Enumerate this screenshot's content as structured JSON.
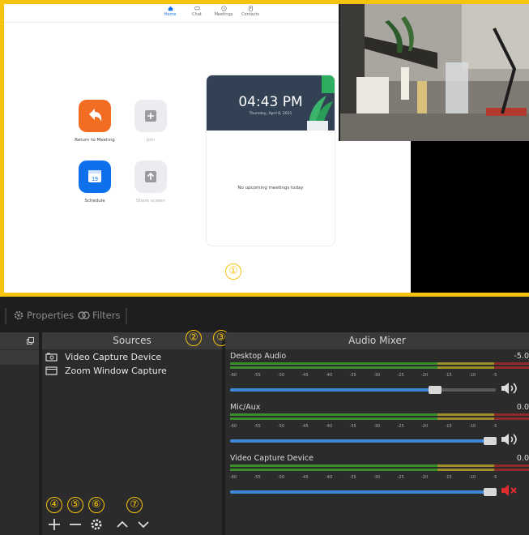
{
  "zoom": {
    "nav": [
      {
        "label": "Home",
        "icon": "home-icon",
        "active": true
      },
      {
        "label": "Chat",
        "icon": "chat-icon",
        "active": false
      },
      {
        "label": "Meetings",
        "icon": "clock-icon",
        "active": false
      },
      {
        "label": "Contacts",
        "icon": "contacts-icon",
        "active": false
      }
    ],
    "actions": [
      {
        "label": "Return to Meeting",
        "color": "#f26d21",
        "icon": "return-arrow-icon"
      },
      {
        "label": "Join",
        "color": "#ececf0",
        "icon": "plus-icon"
      },
      {
        "label": "Schedule",
        "color": "#0e71eb",
        "icon": "calendar-icon",
        "day": "19"
      },
      {
        "label": "Share screen",
        "color": "#ececf0",
        "icon": "share-up-arrow-icon"
      }
    ],
    "card": {
      "time": "04:43 PM",
      "date": "Thursday, April 8, 2021",
      "empty_text": "No upcoming meetings today"
    }
  },
  "annotations": [
    "①",
    "②",
    "③",
    "④",
    "⑤",
    "⑥",
    "⑦"
  ],
  "toolbar": {
    "properties": "Properties",
    "filters": "Filters"
  },
  "sources": {
    "header": "Sources",
    "items": [
      {
        "name": "Video Capture Device",
        "icon": "camera-icon",
        "visible": true,
        "locked": true
      },
      {
        "name": "Zoom Window Capture",
        "icon": "window-icon",
        "visible": true,
        "locked": true
      }
    ]
  },
  "mixer": {
    "header": "Audio Mixer",
    "scale": [
      "-60",
      "-55",
      "-50",
      "-45",
      "-40",
      "-35",
      "-30",
      "-25",
      "-20",
      "-15",
      "-10",
      "-5"
    ],
    "tracks": [
      {
        "name": "Desktop Audio",
        "db": "-5.0",
        "volume": 0.77,
        "muted": false
      },
      {
        "name": "Mic/Aux",
        "db": "0.0",
        "volume": 0.98,
        "muted": false
      },
      {
        "name": "Video Capture Device",
        "db": "0.0",
        "volume": 0.98,
        "muted": true
      }
    ]
  },
  "colors": {
    "accent": "#f6c40f",
    "meter_green": "#3a8f2c",
    "meter_yellow": "#9c8f2a",
    "meter_red": "#8f2a2a",
    "slider_blue": "#3f88d8"
  }
}
